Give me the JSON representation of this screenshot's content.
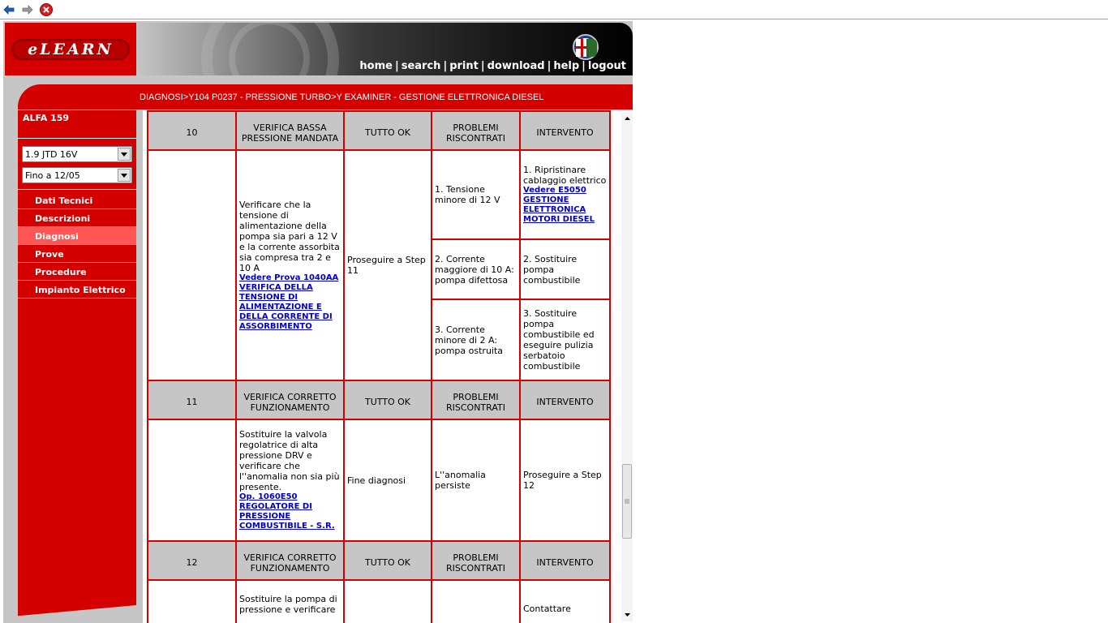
{
  "browser": {
    "back_icon": "back-arrow-icon",
    "forward_icon": "forward-arrow-icon",
    "stop_icon": "close-icon"
  },
  "header": {
    "logo_text": "eLEARN",
    "nav": [
      "home",
      "search",
      "print",
      "download",
      "help",
      "logout"
    ]
  },
  "breadcrumb": "DIAGNOSI>Y104 P0237 - PRESSIONE TURBO>Y EXAMINER - GESTIONE ELETTRONICA DIESEL",
  "sidebar": {
    "model": "ALFA 159",
    "engine_select": "1.9 JTD 16V",
    "date_select": "Fino a 12/05",
    "items": [
      {
        "label": "Dati Tecnici"
      },
      {
        "label": "Descrizioni"
      },
      {
        "label": "Diagnosi",
        "active": true
      },
      {
        "label": "Prove"
      },
      {
        "label": "Procedure"
      },
      {
        "label": "Impianto Elettrico"
      }
    ]
  },
  "table": {
    "step10": {
      "number": "10",
      "title": "VERIFICA BASSA PRESSIONE MANDATA",
      "ok": "TUTTO OK",
      "problems": "PROBLEMI RISCONTRATI",
      "intervention": "INTERVENTO",
      "description": "Verificare che la tensione di alimentazione della pompa sia pari a 12 V e la corrente assorbita sia compresa tra 2 e 10 A",
      "link": " Vedere Prova 1040AA VERIFICA DELLA TENSIONE DI ALIMENTAZIONE E DELLA CORRENTE DI ASSORBIMENTO",
      "ok_action": "Proseguire a Step 11",
      "rows": [
        {
          "problem": "1. Tensione minore di 12 V",
          "fix": "1. Ripristinare cablaggio elettrico",
          "fix_link": " Vedere E5050 GESTIONE ELETTRONICA MOTORI DIESEL"
        },
        {
          "problem": "2. Corrente maggiore di 10 A: pompa difettosa",
          "fix": "2. Sostituire pompa combustibile"
        },
        {
          "problem": "3. Corrente minore di 2 A: pompa ostruita",
          "fix": "3. Sostituire pompa combustibile ed eseguire pulizia serbatoio combustibile"
        }
      ]
    },
    "step11": {
      "number": "11",
      "title": "VERIFICA CORRETTO FUNZIONAMENTO",
      "ok": "TUTTO OK",
      "problems": "PROBLEMI RISCONTRATI",
      "intervention": "INTERVENTO",
      "description": "Sostituire la valvola regolatrice di alta pressione DRV e verificare che l''anomalia non sia più presente.",
      "link": " Op. 1060E50 REGOLATORE DI PRESSIONE COMBUSTIBILE - S.R.",
      "ok_action": "Fine diagnosi",
      "problem": "L''anomalia persiste",
      "fix": "Proseguire a Step 12"
    },
    "step12": {
      "number": "12",
      "title": "VERIFICA CORRETTO FUNZIONAMENTO",
      "ok": "TUTTO OK",
      "problems": "PROBLEMI RISCONTRATI",
      "intervention": "INTERVENTO",
      "description": "Sostituire la pompa di pressione e verificare",
      "fix": "Contattare"
    }
  }
}
